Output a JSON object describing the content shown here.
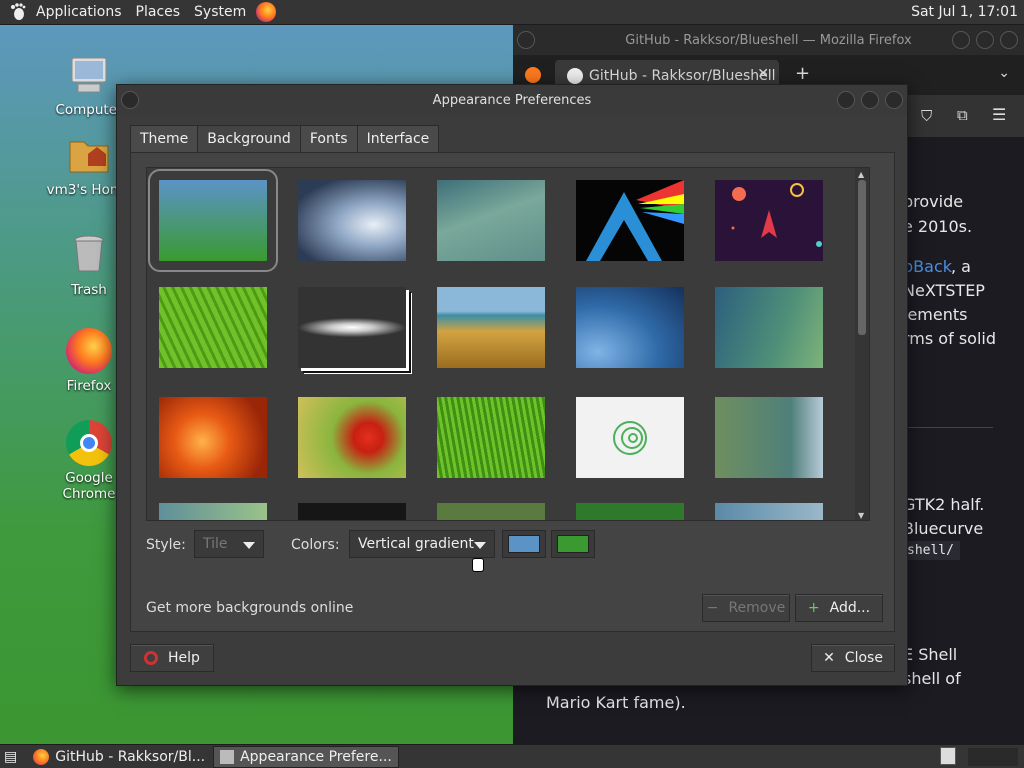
{
  "topbar": {
    "menus": [
      "Applications",
      "Places",
      "System"
    ],
    "clock": "Sat Jul  1, 17:01"
  },
  "desktop": {
    "icons": [
      {
        "label": "Computer",
        "icon": "computer-icon"
      },
      {
        "label": "vm3's Home",
        "icon": "home-folder-icon"
      },
      {
        "label": "Trash",
        "icon": "trash-icon"
      },
      {
        "label": "Firefox",
        "icon": "firefox-icon"
      },
      {
        "label": "Google Chrome",
        "icon": "chrome-icon"
      }
    ]
  },
  "firefox": {
    "window_title": "GitHub - Rakksor/Blueshell — Mozilla Firefox",
    "tab_title": "GitHub - Rakksor/Blueshell",
    "new_tab": "+",
    "content_lines": [
      "provide",
      "e 2010s.",
      "pBack",
      ", a",
      "NeXTSTEP",
      "lements",
      "rms of solid",
      "GTK2 half.",
      "Bluecurve",
      "shell/",
      "E Shell",
      "shell of",
      "Mario Kart fame)."
    ]
  },
  "dialog": {
    "title": "Appearance Preferences",
    "tabs": [
      "Theme",
      "Background",
      "Fonts",
      "Interface"
    ],
    "active_tab": "Background",
    "style_label": "Style:",
    "style_value": "Tile",
    "colors_label": "Colors:",
    "colors_value": "Vertical gradient",
    "primary_color": "#5b93c7",
    "secondary_color": "#3a9a2f",
    "get_more": "Get more backgrounds online",
    "remove_label": "Remove",
    "add_label": "Add...",
    "help_label": "Help",
    "close_label": "Close",
    "wallpapers": [
      "Vertical gradient (selected)",
      "Water drop",
      "Blurred green",
      "Arch triangle",
      "Space rocket",
      "Green leaf",
      "Sombrero galaxy",
      "Grass field beach",
      "Blue leaf drops",
      "Blue green gradient",
      "Orange flower",
      "Red flower",
      "Green grass",
      "Debian swirl",
      "Teal gradient"
    ]
  },
  "taskbar": {
    "tasks": [
      "GitHub - Rakksor/Bl...",
      "Appearance Prefere..."
    ]
  }
}
